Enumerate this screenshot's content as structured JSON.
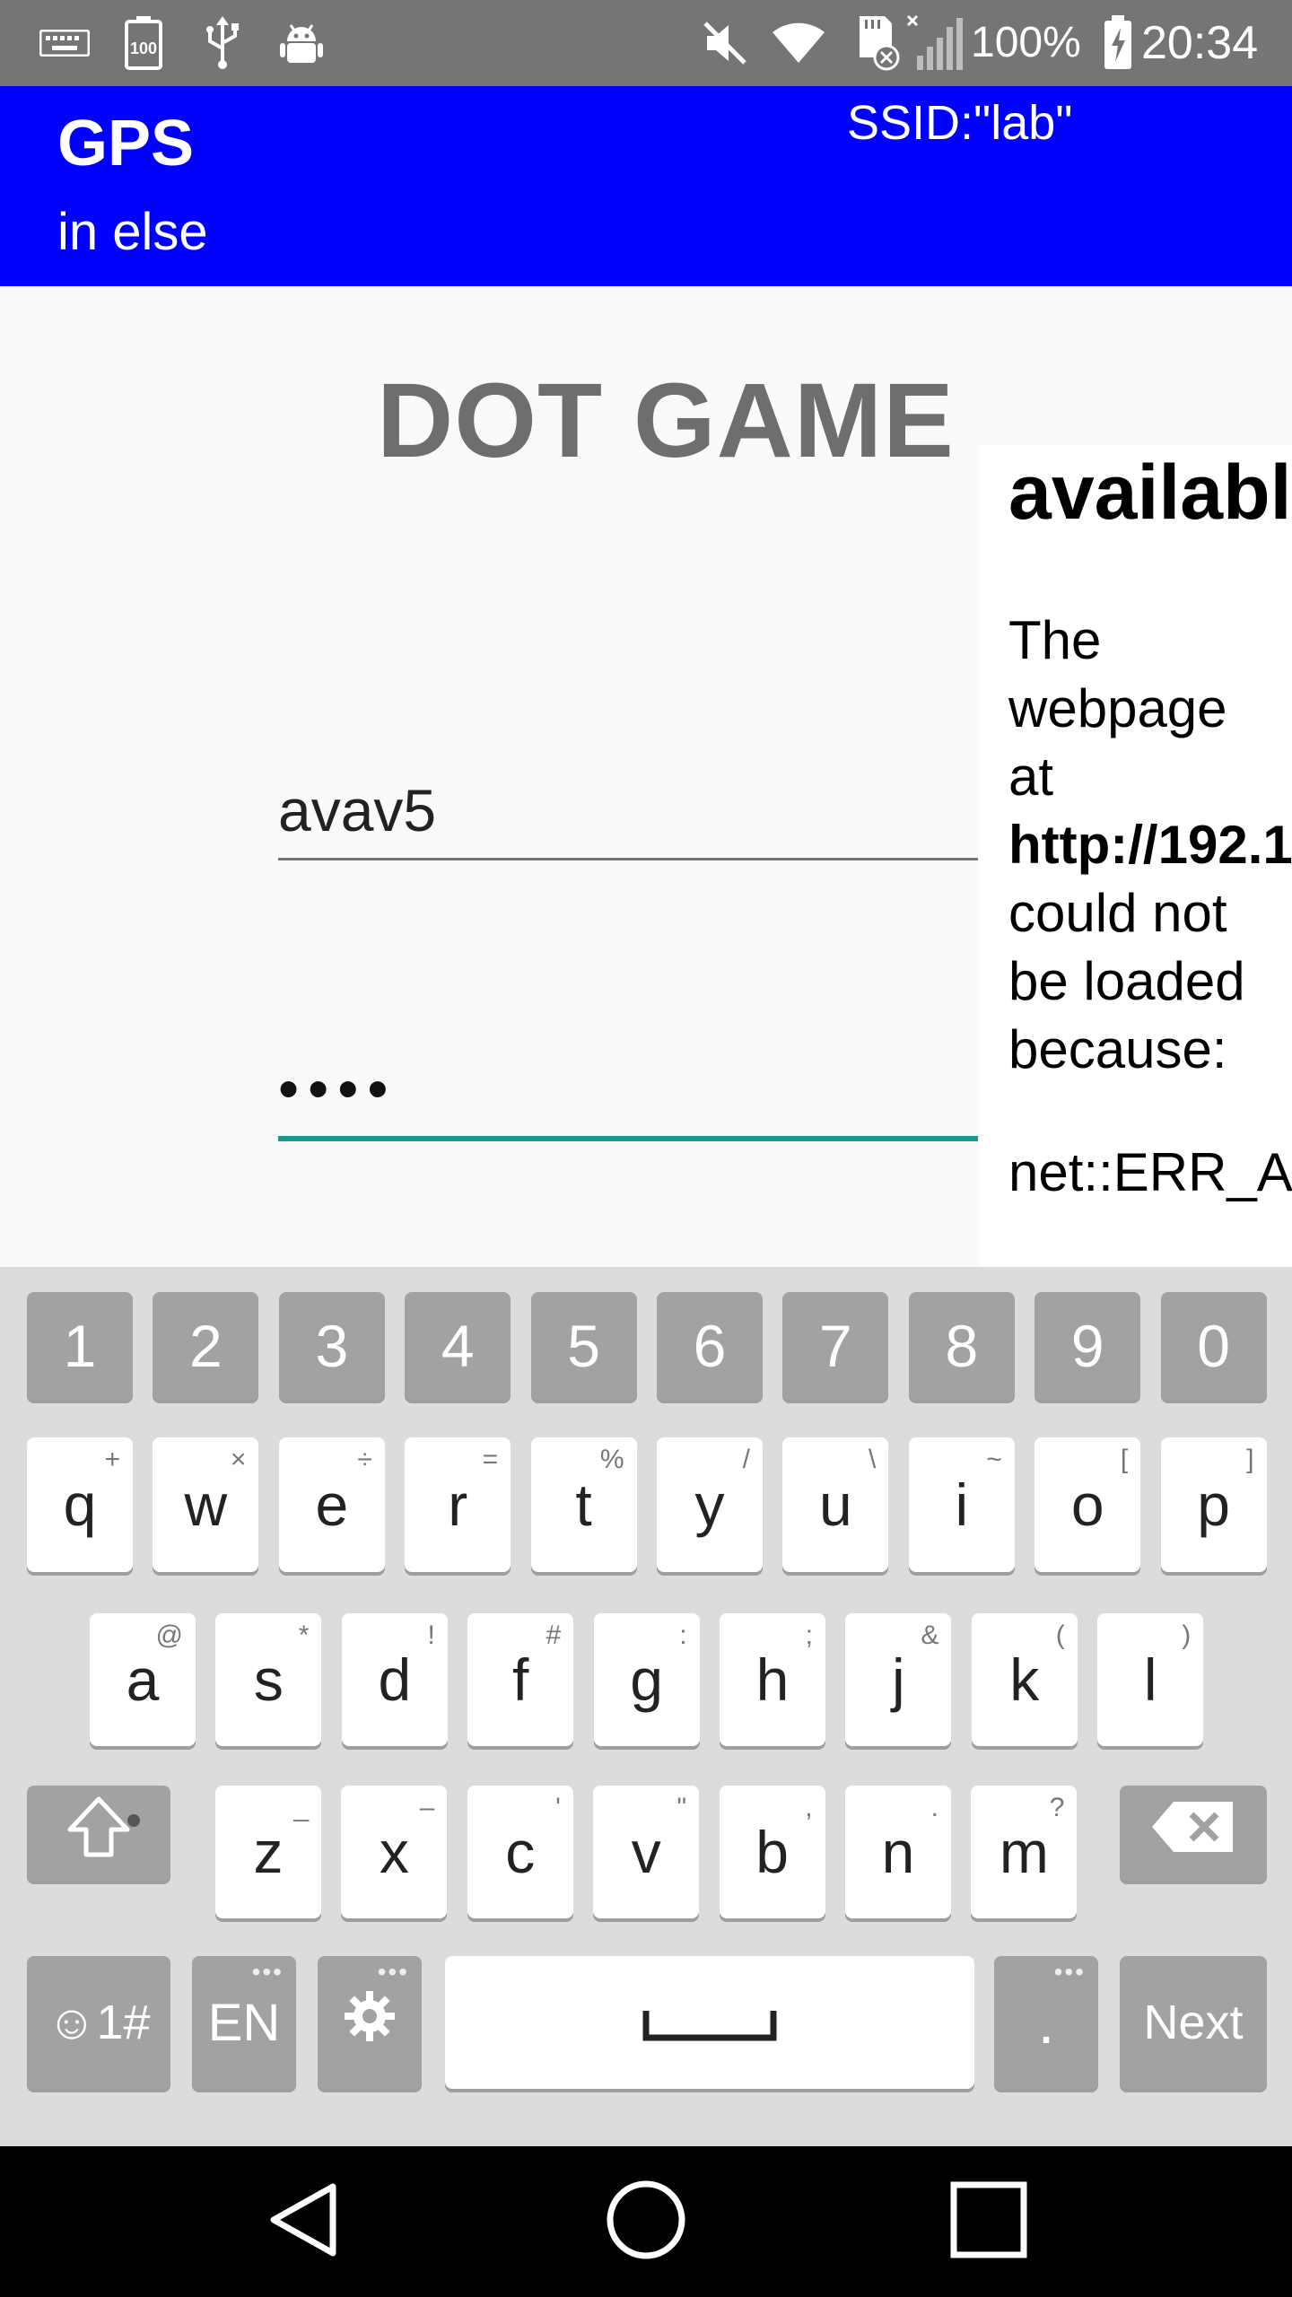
{
  "status_bar": {
    "icons": [
      "keyboard-icon",
      "battery-100-icon",
      "usb-icon",
      "android-debug-icon",
      "mute-icon",
      "wifi-icon",
      "sd-card-icon",
      "no-signal-icon",
      "battery-charging-icon"
    ],
    "battery_text": "100%",
    "time": "20:34"
  },
  "app_bar": {
    "title": "GPS",
    "subtitle": "in else",
    "ssid": "SSID:\"lab\""
  },
  "main": {
    "game_title": "DOT GAME",
    "username_value": "avav5",
    "password_value": "••••"
  },
  "error_panel": {
    "heading": "availabl",
    "body_lines": [
      "The",
      "webpage",
      "at",
      "http://192.1",
      "could not",
      "be loaded",
      "because:"
    ],
    "error_code": "net::ERR_AI"
  },
  "keyboard": {
    "number_row": [
      "1",
      "2",
      "3",
      "4",
      "5",
      "6",
      "7",
      "8",
      "9",
      "0"
    ],
    "row1": [
      {
        "label": "q",
        "sub": "+"
      },
      {
        "label": "w",
        "sub": "×"
      },
      {
        "label": "e",
        "sub": "÷"
      },
      {
        "label": "r",
        "sub": "="
      },
      {
        "label": "t",
        "sub": "%"
      },
      {
        "label": "y",
        "sub": "/"
      },
      {
        "label": "u",
        "sub": "\\"
      },
      {
        "label": "i",
        "sub": "~"
      },
      {
        "label": "o",
        "sub": "["
      },
      {
        "label": "p",
        "sub": "]"
      }
    ],
    "row2": [
      {
        "label": "a",
        "sub": "@"
      },
      {
        "label": "s",
        "sub": "*"
      },
      {
        "label": "d",
        "sub": "!"
      },
      {
        "label": "f",
        "sub": "#"
      },
      {
        "label": "g",
        "sub": ":"
      },
      {
        "label": "h",
        "sub": ";"
      },
      {
        "label": "j",
        "sub": "&"
      },
      {
        "label": "k",
        "sub": "("
      },
      {
        "label": "l",
        "sub": ")"
      }
    ],
    "row3": [
      {
        "label": "z",
        "sub": "_"
      },
      {
        "label": "x",
        "sub": "–"
      },
      {
        "label": "c",
        "sub": "'"
      },
      {
        "label": "v",
        "sub": "\""
      },
      {
        "label": "b",
        "sub": ","
      },
      {
        "label": "n",
        "sub": "."
      },
      {
        "label": "m",
        "sub": "?"
      }
    ],
    "emoji_label": "☺1#",
    "lang_label": "EN",
    "period_label": ".",
    "next_label": "Next"
  },
  "colors": {
    "app_bar": "#0000ff",
    "status_bar": "#757575",
    "focus_underline": "#15998a",
    "keyboard_bg": "#dcdcdc"
  }
}
